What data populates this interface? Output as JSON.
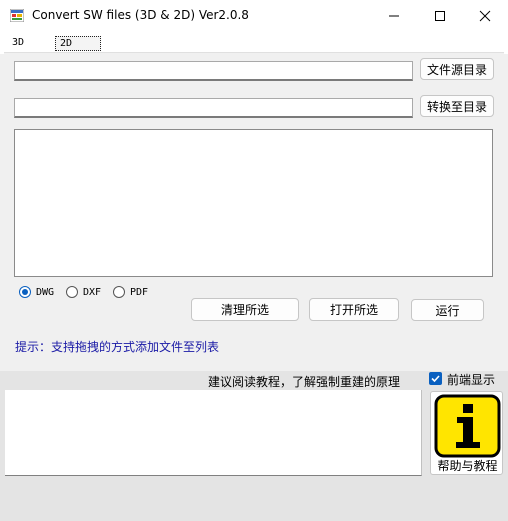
{
  "window": {
    "title": "Convert SW files (3D & 2D) Ver2.0.8",
    "icons": [
      "app-icon",
      "minimize-icon",
      "maximize-icon",
      "close-icon"
    ]
  },
  "tabs": [
    {
      "label": "3D",
      "active": false
    },
    {
      "label": "2D",
      "active": true
    }
  ],
  "source": {
    "value": "",
    "button_label": "文件源目录"
  },
  "target": {
    "value": "",
    "button_label": "转换至目录"
  },
  "file_list": {
    "items": []
  },
  "formats": [
    {
      "label": "DWG",
      "selected": true
    },
    {
      "label": "DXF",
      "selected": false
    },
    {
      "label": "PDF",
      "selected": false
    }
  ],
  "actions": {
    "clear_label": "清理所选",
    "open_label": "打开所选",
    "run_label": "运行"
  },
  "hint": "提示：支持拖拽的方式添加文件至列表",
  "lower": {
    "tip": "建议阅读教程，了解强制重建的原理",
    "topmost_label": "前端显示",
    "topmost_checked": true,
    "log_text": "",
    "help_label": "帮助与教程"
  },
  "colors": {
    "accent": "#0a60c0",
    "hint_text": "#1a1aa6",
    "help_icon_yellow": "#ffe500"
  }
}
